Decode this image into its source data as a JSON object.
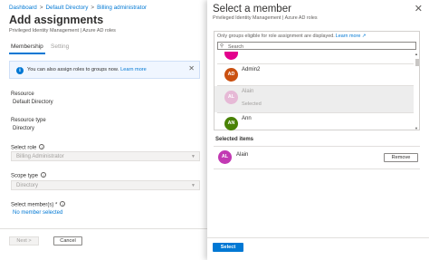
{
  "breadcrumb": {
    "items": [
      "Dashboard",
      "Default Directory",
      "Billing administrator"
    ],
    "separator": ">"
  },
  "page": {
    "title": "Add assignments",
    "more": "...",
    "subtitle": "Privileged Identity Management | Azure AD roles"
  },
  "tabs": [
    {
      "label": "Membership",
      "active": true
    },
    {
      "label": "Setting",
      "active": false
    }
  ],
  "info_bar": {
    "icon": "info-icon",
    "text": "You can also assign roles to groups now.",
    "link": "Learn more",
    "close": "✕"
  },
  "form": {
    "resource_label": "Resource",
    "resource_value": "Default Directory",
    "resource_type_label": "Resource type",
    "resource_type_value": "Directory",
    "select_role_label": "Select role",
    "select_role_value": "Billing Administrator",
    "scope_type_label": "Scope type",
    "scope_type_value": "Directory",
    "select_members_label": "Select member(s) *",
    "no_member_text": "No member selected",
    "help_glyph": "i"
  },
  "footer": {
    "next_label": "Next >",
    "cancel_label": "Cancel"
  },
  "member_panel": {
    "title": "Select a member",
    "subtitle": "Privileged Identity Management | Azure AD roles",
    "close": "✕",
    "note": "Only groups eligible for role assignment are displayed.",
    "note_link": "Learn more",
    "note_link_icon": "↗",
    "search_placeholder": "Search",
    "members": [
      {
        "initials": "",
        "name": "",
        "meta": "",
        "color": "#e3008c",
        "text_color": "#ffffff",
        "selected": false
      },
      {
        "initials": "AD",
        "name": "Admin2",
        "meta": "",
        "color": "#ca5010",
        "text_color": "#ffffff",
        "selected": false
      },
      {
        "initials": "AL",
        "name": "Alain",
        "meta": "Selected",
        "color": "#e6b9d6",
        "text_color": "#ffffff",
        "selected": true
      },
      {
        "initials": "AN",
        "name": "Ann",
        "meta": "",
        "color": "#498205",
        "text_color": "#ffffff",
        "selected": false
      }
    ],
    "selected_title": "Selected items",
    "selected_items": [
      {
        "initials": "AL",
        "name": "Alain",
        "color": "#c239b3"
      }
    ],
    "remove_label": "Remove",
    "select_label": "Select"
  },
  "colors": {
    "accent": "#0078d4",
    "disabled_text": "#a19f9d",
    "info_background": "#f0f6ff"
  }
}
